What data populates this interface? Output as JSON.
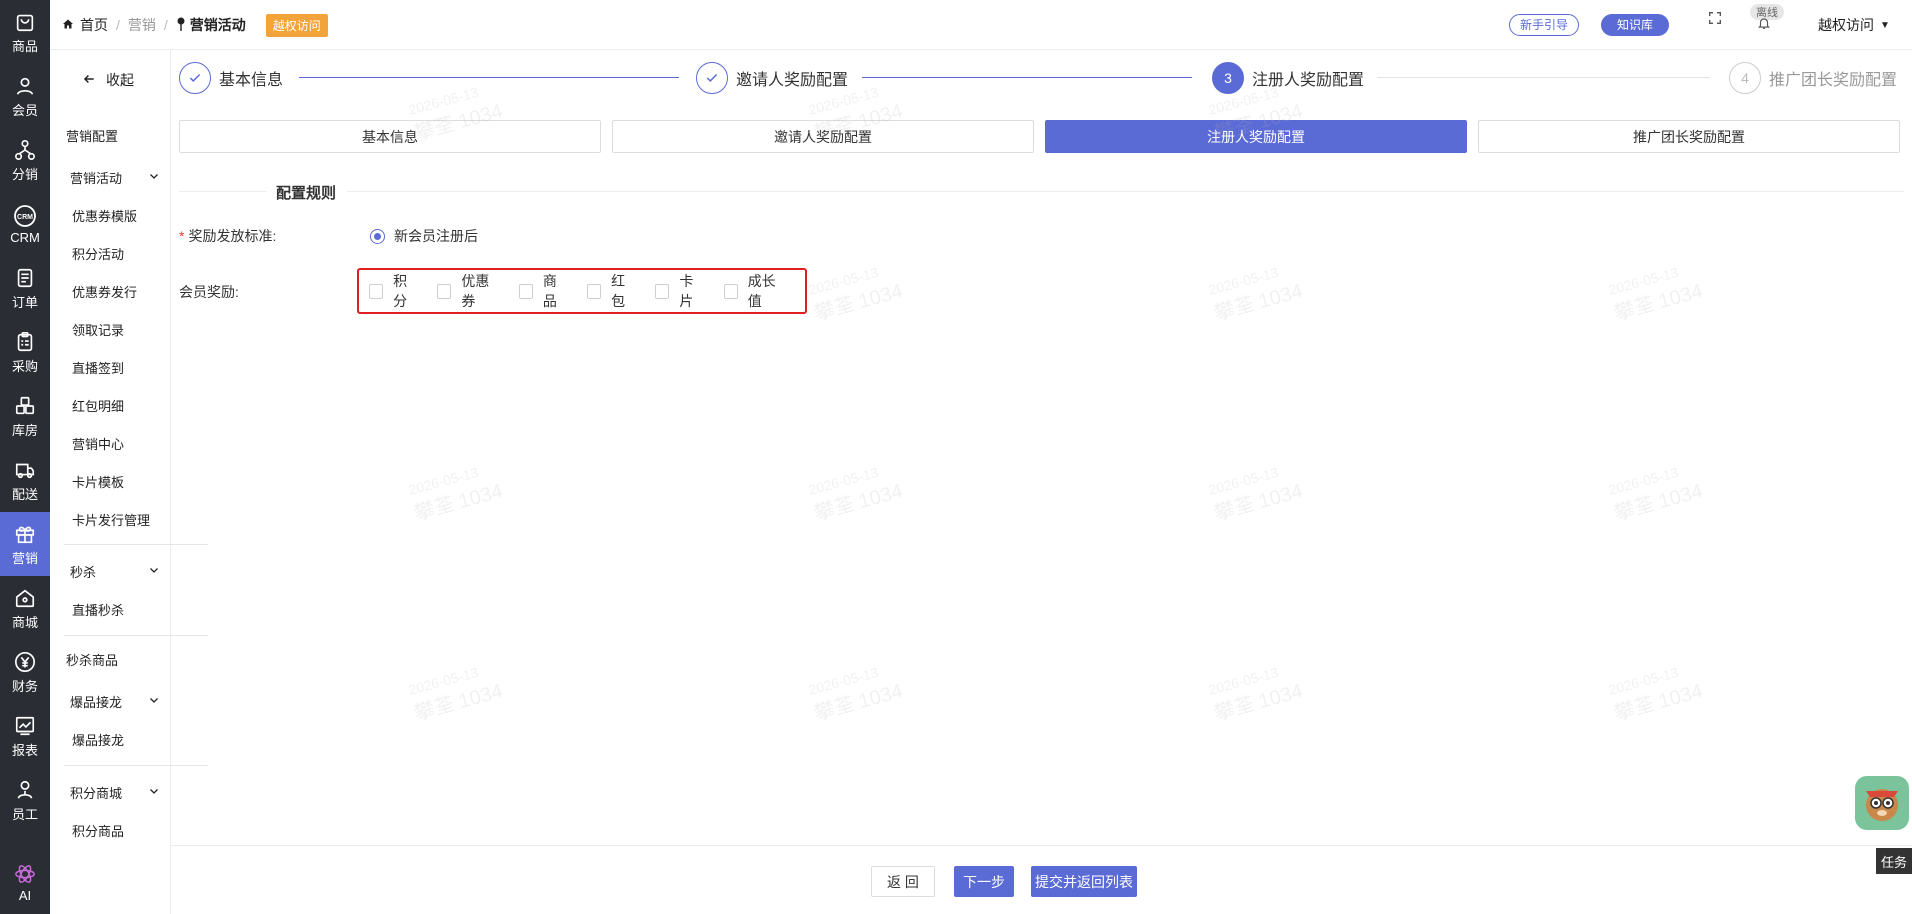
{
  "rail": {
    "items": [
      {
        "label": "商品",
        "icon": "bag-icon"
      },
      {
        "label": "会员",
        "icon": "user-icon"
      },
      {
        "label": "分销",
        "icon": "network-icon"
      },
      {
        "label": "CRM",
        "icon": "crm-icon"
      },
      {
        "label": "订单",
        "icon": "order-icon"
      },
      {
        "label": "采购",
        "icon": "clipboard-icon"
      },
      {
        "label": "库房",
        "icon": "warehouse-icon"
      },
      {
        "label": "配送",
        "icon": "delivery-icon"
      },
      {
        "label": "营销",
        "icon": "gift-icon",
        "active": true
      },
      {
        "label": "商城",
        "icon": "home-icon"
      },
      {
        "label": "财务",
        "icon": "yen-icon"
      },
      {
        "label": "报表",
        "icon": "chart-icon"
      },
      {
        "label": "员工",
        "icon": "staff-icon"
      },
      {
        "label": "AI",
        "icon": "ai-icon"
      }
    ]
  },
  "topbar": {
    "breadcrumb": {
      "home": "首页",
      "parent": "营销",
      "current": "营销活动"
    },
    "tag": "越权访问",
    "guide": "新手引导",
    "knowledge": "知识库",
    "offline": "离线",
    "user": "越权访问"
  },
  "subnav": {
    "collapse": "收起",
    "top": "营销配置",
    "group1": "营销活动",
    "group1_items": [
      "优惠券模版",
      "积分活动",
      "优惠券发行",
      "领取记录",
      "直播签到",
      "红包明细",
      "营销中心",
      "卡片模板",
      "卡片发行管理"
    ],
    "group2": "秒杀",
    "group2_items": [
      "直播秒杀"
    ],
    "standalone": "秒杀商品",
    "group3": "爆品接龙",
    "group3_items": [
      "爆品接龙"
    ],
    "group4": "积分商城",
    "group4_items": [
      "积分商品"
    ]
  },
  "steps": [
    {
      "label": "基本信息",
      "status": "done"
    },
    {
      "label": "邀请人奖励配置",
      "status": "done"
    },
    {
      "num": "3",
      "label": "注册人奖励配置",
      "status": "active"
    },
    {
      "num": "4",
      "label": "推广团长奖励配置",
      "status": "todo"
    }
  ],
  "tabs": [
    "基本信息",
    "邀请人奖励配置",
    "注册人奖励配置",
    "推广团长奖励配置"
  ],
  "form": {
    "section_title": "配置规则",
    "standard_label": "奖励发放标准:",
    "standard_option": "新会员注册后",
    "reward_label": "会员奖励:",
    "reward_options": [
      "积分",
      "优惠券",
      "商品",
      "红包",
      "卡片",
      "成长值"
    ]
  },
  "footer": {
    "back": "返 回",
    "next": "下一步",
    "submit": "提交并返回列表"
  },
  "watermark": {
    "date": "2026-05-13",
    "name": "攀荃 1034"
  },
  "task": "任务",
  "colors": {
    "accent": "#5b6bd5",
    "rail_bg": "#2b2d35",
    "tag": "#f2a43a",
    "highlight": "#e02020"
  }
}
